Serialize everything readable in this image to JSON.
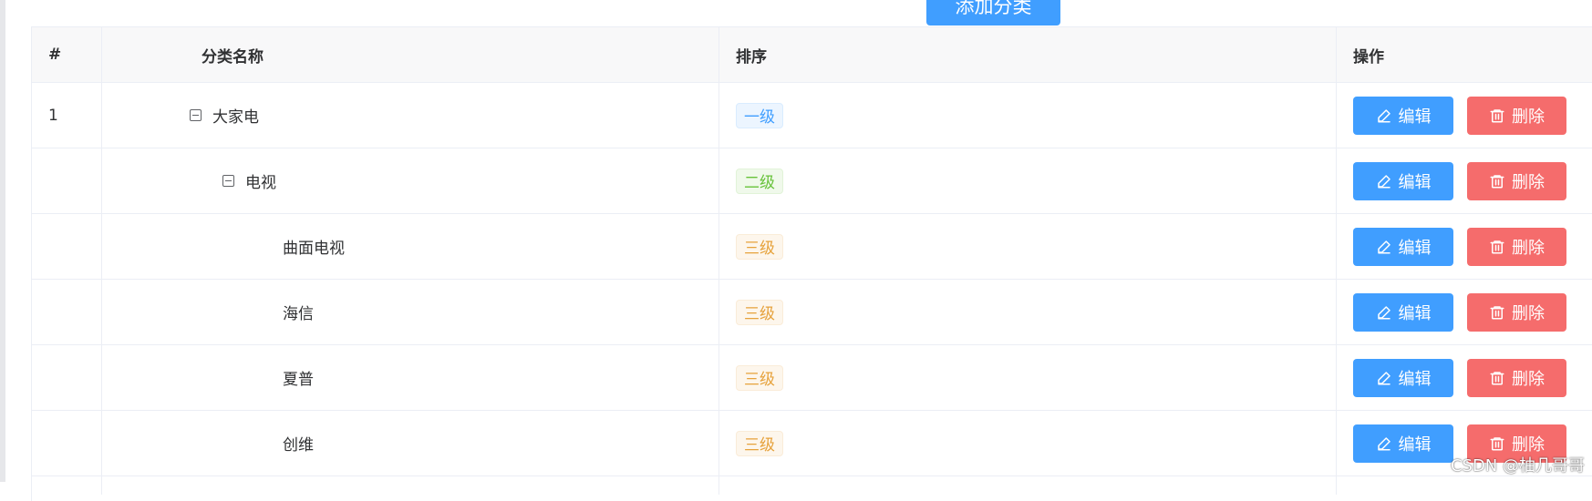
{
  "toolbar": {
    "add_label": "添加分类"
  },
  "table": {
    "headers": {
      "index": "#",
      "name": "分类名称",
      "sort": "排序",
      "actions": "操作"
    },
    "edit_label": "编辑",
    "delete_label": "删除",
    "rows": [
      {
        "index": "1",
        "name": "大家电",
        "level_tag": "一级",
        "level": 1,
        "expanded": true
      },
      {
        "index": "",
        "name": "电视",
        "level_tag": "二级",
        "level": 2,
        "expanded": true
      },
      {
        "index": "",
        "name": "曲面电视",
        "level_tag": "三级",
        "level": 3
      },
      {
        "index": "",
        "name": "海信",
        "level_tag": "三级",
        "level": 3
      },
      {
        "index": "",
        "name": "夏普",
        "level_tag": "三级",
        "level": 3
      },
      {
        "index": "",
        "name": "创维",
        "level_tag": "三级",
        "level": 3
      }
    ]
  },
  "colors": {
    "primary": "#409eff",
    "danger": "#f56c6c",
    "success": "#67c23a",
    "warning": "#e6a23c"
  },
  "watermark": "CSDN @柚几哥哥"
}
